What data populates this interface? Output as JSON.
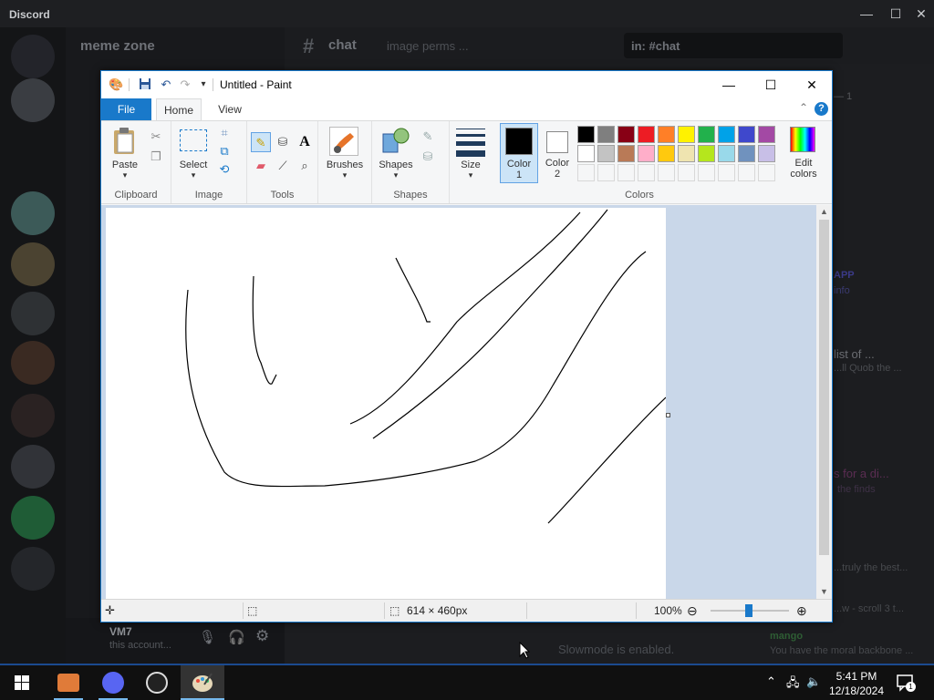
{
  "discord": {
    "brand": "Discord",
    "server_name": "meme zone",
    "channel_name": "chat",
    "topic": "image perms ...",
    "search_placeholder": "in: #chat",
    "user": {
      "name": "VM7",
      "status": "this account..."
    },
    "slowmode": "Slowmode is enabled.",
    "chat_fragments": [
      {
        "text": "mango",
        "color": "#2e5d34"
      },
      {
        "text": "You have the moral backbone ...",
        "color": "#47494d"
      },
      {
        "text": "list of ...",
        "color": "#6b6d72"
      },
      {
        "text": "...ll Quob the ...",
        "color": "#4a4c50"
      },
      {
        "text": "s for a di...",
        "color": "#5a2d52"
      },
      {
        "text": "the finds",
        "color": "#3f3147"
      },
      {
        "text": "...truly the best...",
        "color": "#47494d"
      },
      {
        "text": "...w - scroll 3 t...",
        "color": "#47494d"
      },
      {
        "text": "APP",
        "color": "#3b3a88"
      },
      {
        "text": "info",
        "color": "#3a3a70"
      },
      {
        "text": "— 1",
        "color": "#56585c"
      }
    ]
  },
  "paint": {
    "title": "Untitled - Paint",
    "tabs": {
      "file": "File",
      "home": "Home",
      "view": "View"
    },
    "groups": {
      "clipboard": "Clipboard",
      "image": "Image",
      "tools": "Tools",
      "shapes": "Shapes",
      "colors": "Colors"
    },
    "buttons": {
      "paste": "Paste",
      "select": "Select",
      "brushes": "Brushes",
      "shapes": "Shapes",
      "size": "Size",
      "color1": "Color",
      "color1_num": "1",
      "color2": "Color",
      "color2_num": "2",
      "edit_colors": "Edit",
      "edit_colors2": "colors"
    },
    "palette_row1": [
      "#000000",
      "#7f7f7f",
      "#880015",
      "#ed1c24",
      "#ff7f27",
      "#fff200",
      "#22b14c",
      "#00a2e8",
      "#3f48cc",
      "#a349a4"
    ],
    "palette_row2": [
      "#ffffff",
      "#c3c3c3",
      "#b97a57",
      "#ffaec9",
      "#ffc90e",
      "#efe4b0",
      "#b5e61d",
      "#99d9ea",
      "#7092be",
      "#c8bfe7"
    ],
    "color1_value": "#000000",
    "color2_value": "#ffffff",
    "status": {
      "image_size": "614 × 460px",
      "zoom": "100%"
    }
  },
  "taskbar": {
    "time": "5:41 PM",
    "date": "12/18/2024",
    "notification_count": "1"
  }
}
